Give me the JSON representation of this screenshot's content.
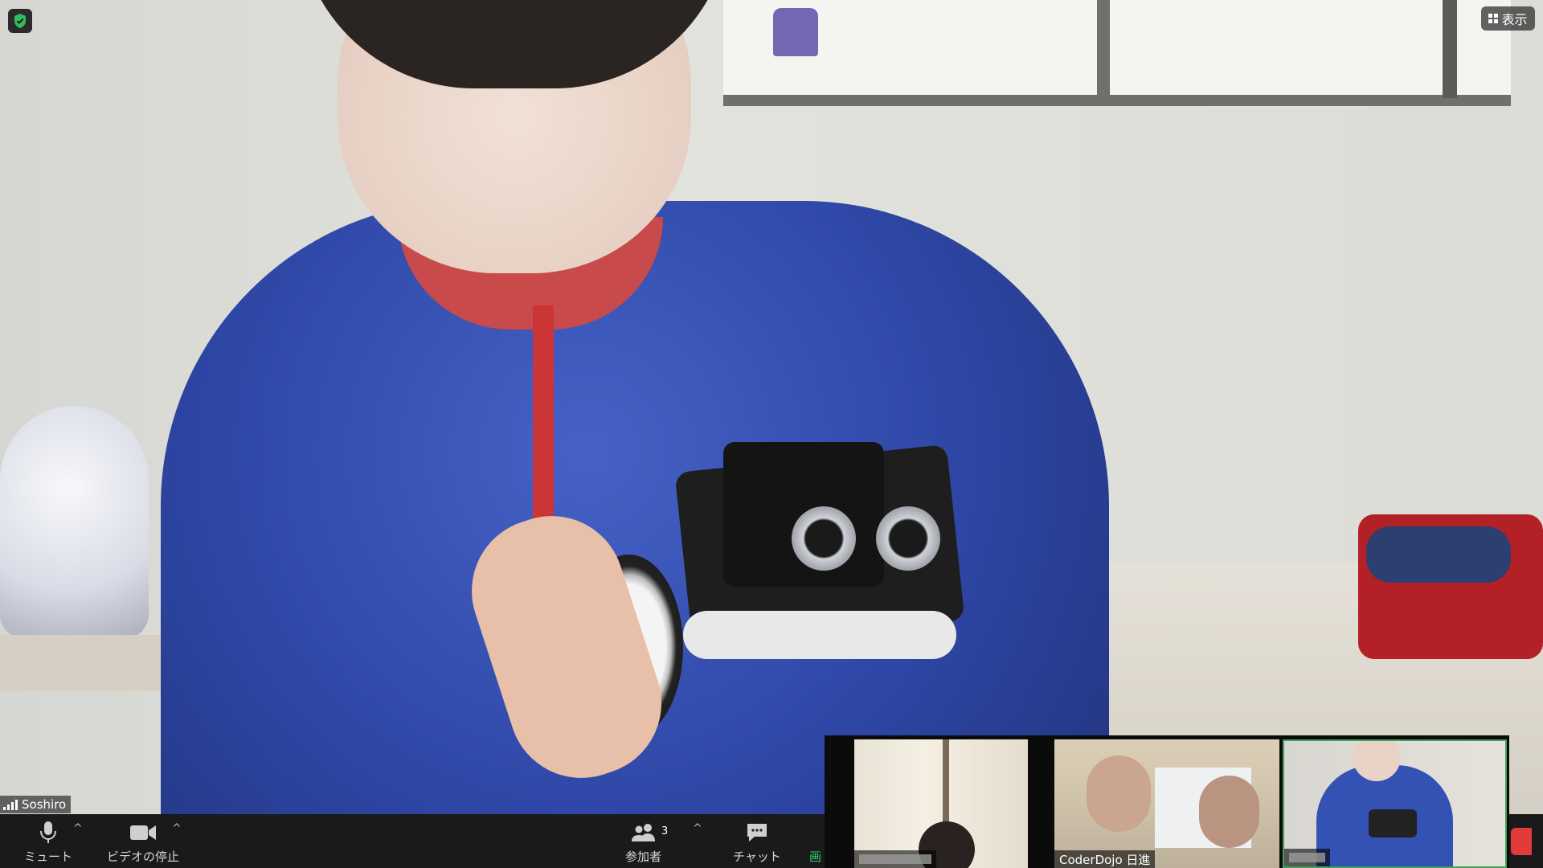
{
  "main_video": {
    "participant_name": "Soshiro"
  },
  "view_button": {
    "label": "表示",
    "icon": "grid-icon"
  },
  "security": {
    "icon": "shield-check-icon",
    "color": "#2fbf5a"
  },
  "toolbar": {
    "mute_label": "ミュート",
    "video_label": "ビデオの停止",
    "participants_label": "参加者",
    "participants_count": "3",
    "chat_label": "チャット",
    "share_label_partial": "画"
  },
  "gallery": {
    "thumbnails": [
      {
        "name": "",
        "name_redacted": true
      },
      {
        "name": "CoderDojo 日進",
        "name_redacted": false
      },
      {
        "name": "",
        "name_redacted": true,
        "active_speaker": true
      }
    ]
  },
  "colors": {
    "toolbar_bg": "#1a1a1a",
    "active_speaker_border": "#3ea356",
    "share_green": "#2fd36b"
  }
}
